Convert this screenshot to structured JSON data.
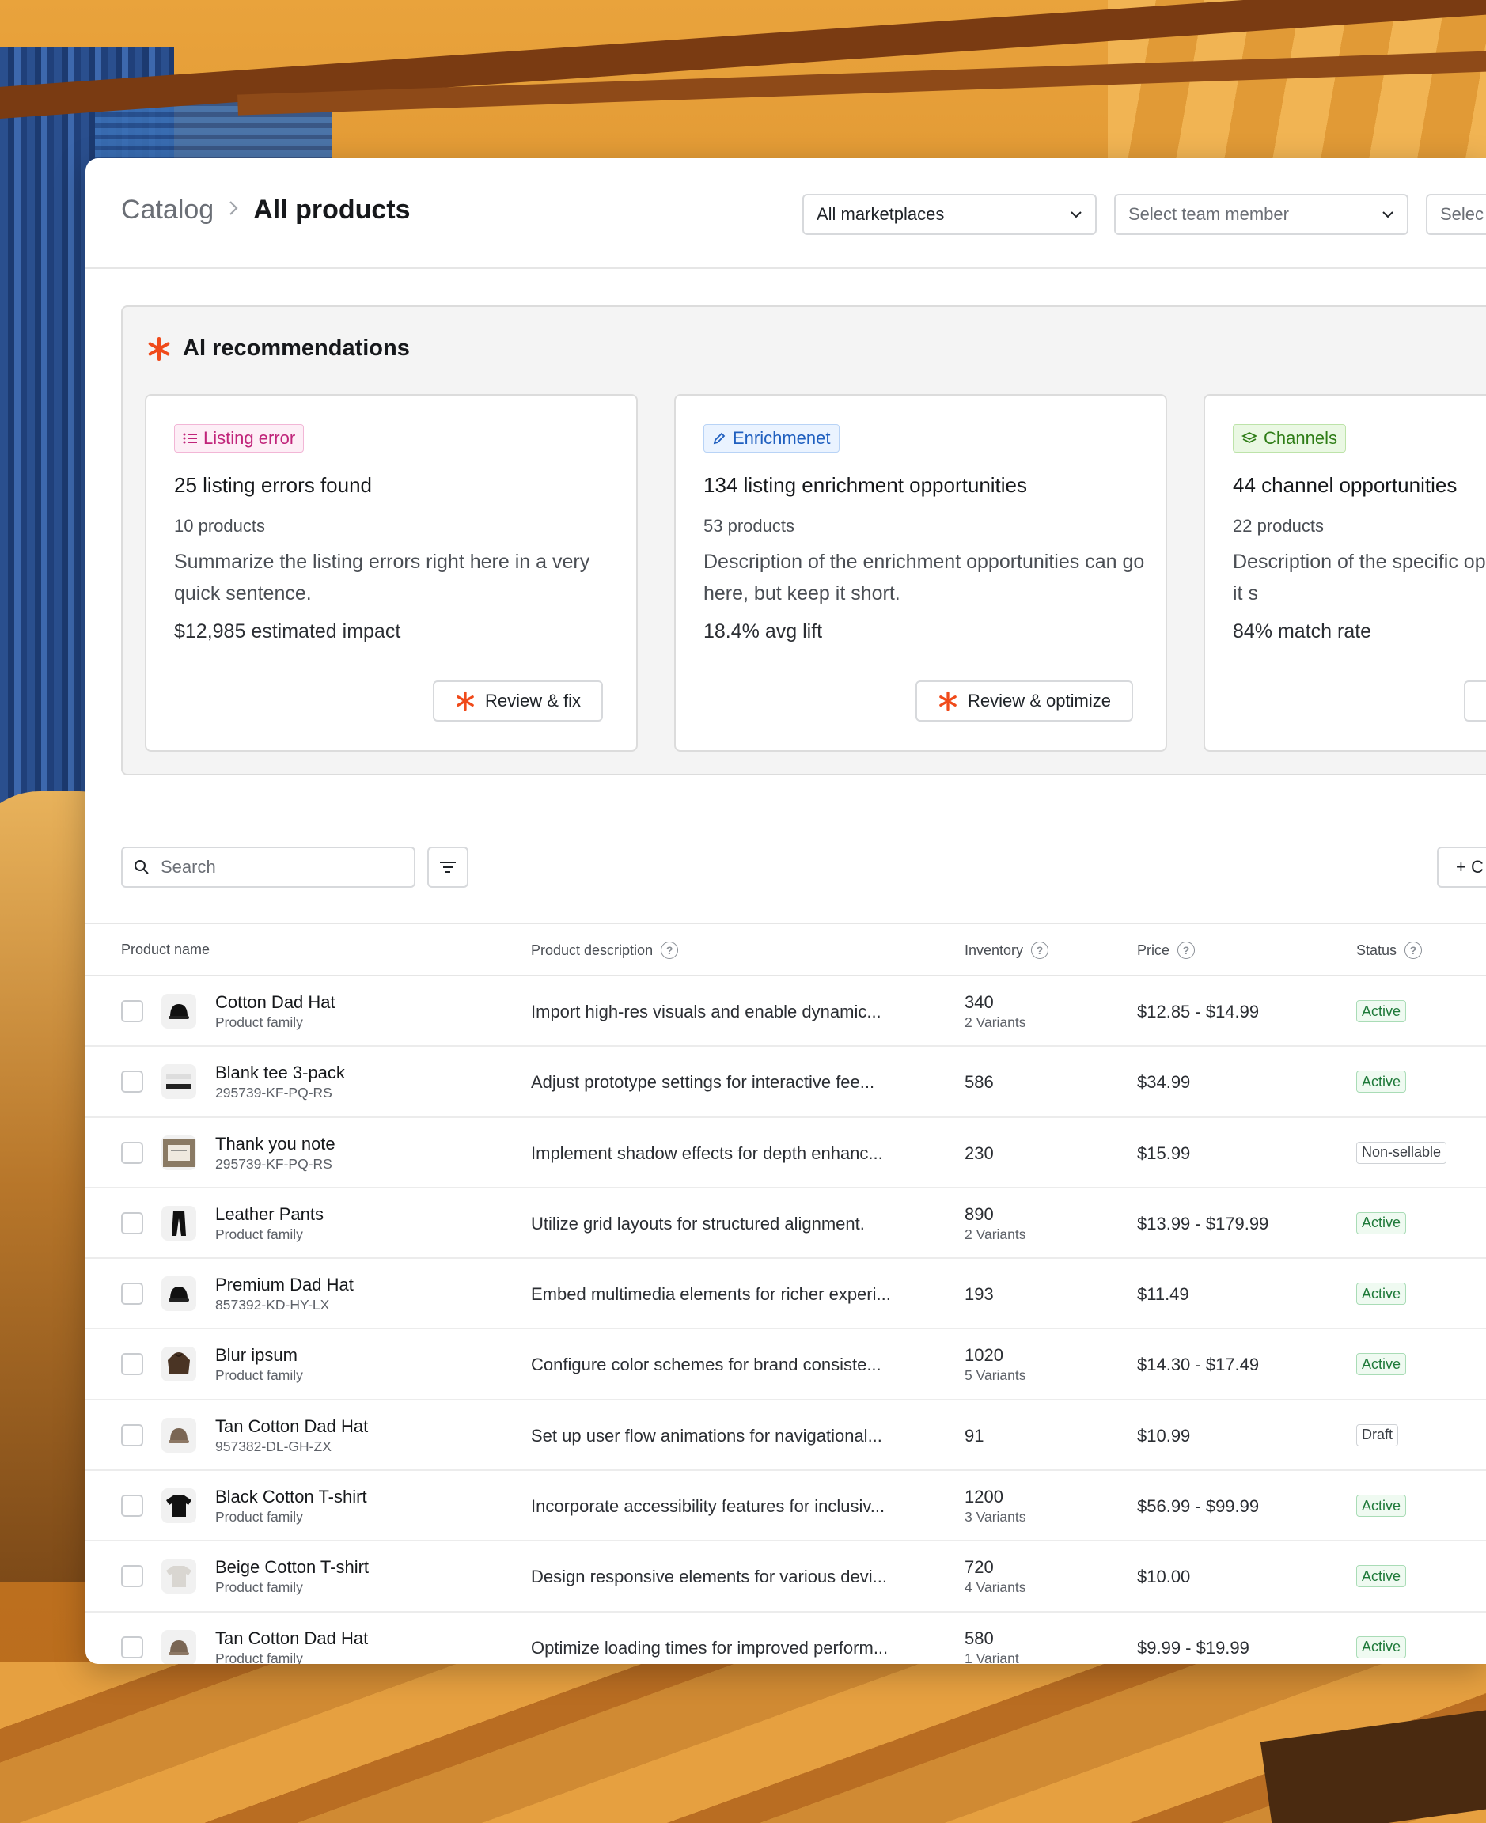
{
  "breadcrumb": {
    "root": "Catalog",
    "current": "All products"
  },
  "filters": {
    "marketplace": "All marketplaces",
    "team_member_placeholder": "Select team member",
    "third_placeholder": "Selec"
  },
  "ai": {
    "title": "AI recommendations",
    "cards": [
      {
        "tag": "Listing error",
        "title": "25 listing errors found",
        "sub": "10 products",
        "desc": "Summarize the listing errors right here in a very quick sentence.",
        "metric": "$12,985 estimated impact",
        "button": "Review & fix"
      },
      {
        "tag": "Enrichmenet",
        "title": "134 listing enrichment opportunities",
        "sub": "53 products",
        "desc": "Description of the enrichment opportunities can go here, but keep it short.",
        "metric": "18.4% avg lift",
        "button": "Review & optimize"
      },
      {
        "tag": "Channels",
        "title": "44 channel opportunities",
        "sub": "22 products",
        "desc": "Description of the specific opportunities, but keep it s",
        "metric": "84% match rate",
        "button": ""
      }
    ]
  },
  "toolbar": {
    "search_placeholder": "Search",
    "create_label": "+ C"
  },
  "table": {
    "columns": {
      "name": "Product name",
      "description": "Product description",
      "inventory": "Inventory",
      "price": "Price",
      "status": "Status"
    },
    "rows": [
      {
        "name": "Cotton Dad Hat",
        "sub": "Product family",
        "desc": "Import high-res visuals and enable dynamic...",
        "inv": "340",
        "variants": "2 Variants",
        "price": "$12.85 - $14.99",
        "status": "Active",
        "icon": "hat-icon"
      },
      {
        "name": "Blank tee 3-pack",
        "sub": "295739-KF-PQ-RS",
        "desc": "Adjust prototype settings for interactive fee...",
        "inv": "586",
        "variants": "",
        "price": "$34.99",
        "status": "Active",
        "icon": "folded-tee-icon"
      },
      {
        "name": "Thank you note",
        "sub": "295739-KF-PQ-RS",
        "desc": "Implement shadow effects for depth enhanc...",
        "inv": "230",
        "variants": "",
        "price": "$15.99",
        "status": "Non-sellable",
        "icon": "note-card-icon"
      },
      {
        "name": "Leather Pants",
        "sub": "Product family",
        "desc": "Utilize grid layouts for structured alignment.",
        "inv": "890",
        "variants": "2 Variants",
        "price": "$13.99 - $179.99",
        "status": "Active",
        "icon": "pants-icon"
      },
      {
        "name": "Premium Dad Hat",
        "sub": "857392-KD-HY-LX",
        "desc": "Embed multimedia elements for richer experi...",
        "inv": "193",
        "variants": "",
        "price": "$11.49",
        "status": "Active",
        "icon": "hat-icon"
      },
      {
        "name": "Blur ipsum",
        "sub": "Product family",
        "desc": "Configure color schemes for brand consiste...",
        "inv": "1020",
        "variants": "5 Variants",
        "price": "$14.30 - $17.49",
        "status": "Active",
        "icon": "hoodie-icon"
      },
      {
        "name": "Tan Cotton Dad Hat",
        "sub": "957382-DL-GH-ZX",
        "desc": "Set up user flow animations for navigational...",
        "inv": "91",
        "variants": "",
        "price": "$10.99",
        "status": "Draft",
        "icon": "tan-hat-icon"
      },
      {
        "name": "Black Cotton T-shirt",
        "sub": "Product family",
        "desc": "Incorporate accessibility features for inclusiv...",
        "inv": "1200",
        "variants": "3 Variants",
        "price": "$56.99 - $99.99",
        "status": "Active",
        "icon": "black-tshirt-icon"
      },
      {
        "name": "Beige Cotton T-shirt",
        "sub": "Product family",
        "desc": "Design responsive elements for various devi...",
        "inv": "720",
        "variants": "4 Variants",
        "price": "$10.00",
        "status": "Active",
        "icon": "beige-tshirt-icon"
      },
      {
        "name": "Tan Cotton Dad Hat",
        "sub": "Product family",
        "desc": "Optimize loading times for improved perform...",
        "inv": "580",
        "variants": "1 Variant",
        "price": "$9.99 - $19.99",
        "status": "Active",
        "icon": "tan-hat-icon"
      }
    ]
  },
  "colors": {
    "accent": "#f04a1a",
    "active_green": "#1f7a3a",
    "listing_pink": "#c0247a",
    "enrich_blue": "#1f5fbf",
    "channels_green": "#2f7d17"
  }
}
